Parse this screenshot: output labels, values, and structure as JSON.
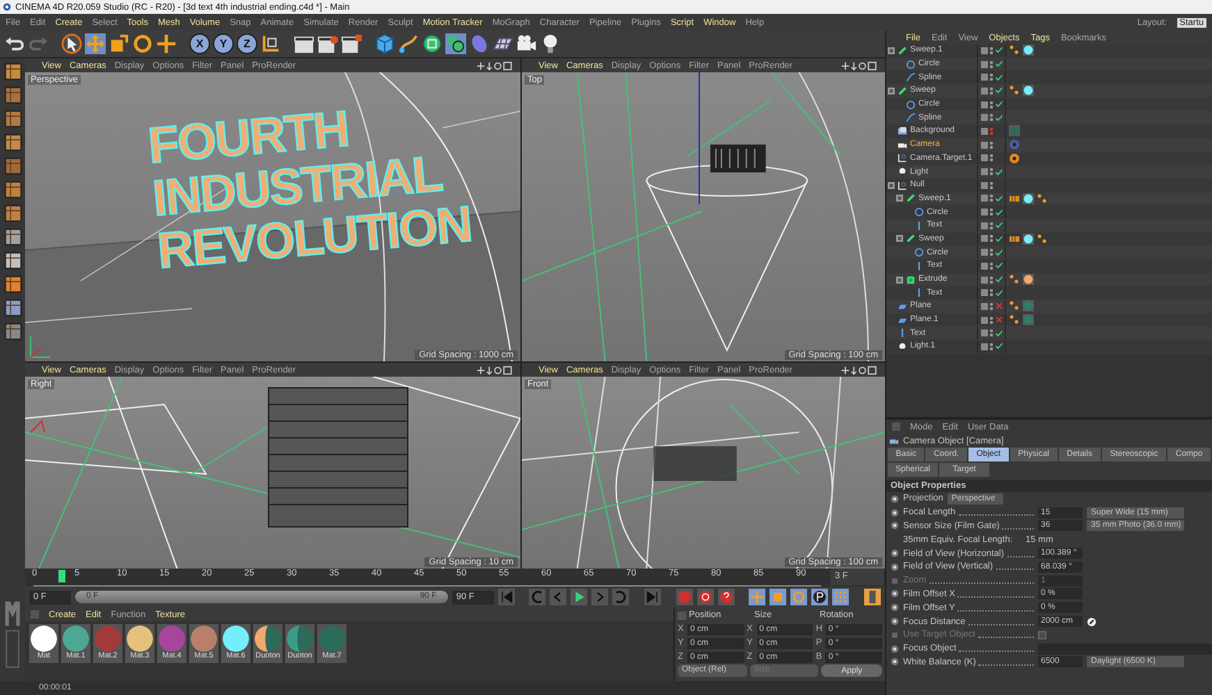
{
  "window": {
    "title": "CINEMA 4D R20.059 Studio (RC - R20) - [3d text 4th industrial ending.c4d *] - Main"
  },
  "menu": [
    {
      "label": "File",
      "highlight": false
    },
    {
      "label": "Edit",
      "highlight": false
    },
    {
      "label": "Create",
      "highlight": true
    },
    {
      "label": "Select",
      "highlight": false
    },
    {
      "label": "Tools",
      "highlight": true
    },
    {
      "label": "Mesh",
      "highlight": true
    },
    {
      "label": "Volume",
      "highlight": true
    },
    {
      "label": "Snap",
      "highlight": false
    },
    {
      "label": "Animate",
      "highlight": false
    },
    {
      "label": "Simulate",
      "highlight": false
    },
    {
      "label": "Render",
      "highlight": false
    },
    {
      "label": "Sculpt",
      "highlight": false
    },
    {
      "label": "Motion Tracker",
      "highlight": true
    },
    {
      "label": "MoGraph",
      "highlight": false
    },
    {
      "label": "Character",
      "highlight": false
    },
    {
      "label": "Pipeline",
      "highlight": false
    },
    {
      "label": "Plugins",
      "highlight": false
    },
    {
      "label": "Script",
      "highlight": true
    },
    {
      "label": "Window",
      "highlight": true
    },
    {
      "label": "Help",
      "highlight": false
    }
  ],
  "layout": {
    "label": "Layout:",
    "value": "Startu"
  },
  "toolbar": {
    "axes": [
      "X",
      "Y",
      "Z"
    ]
  },
  "viewports": [
    {
      "label": "Perspective",
      "kind": "perspective",
      "grid": "Grid Spacing : 1000 cm",
      "scene_text": [
        "FOURTH",
        "INDUSTRIAL",
        "REVOLUTION"
      ],
      "menu": [
        {
          "label": "View",
          "highlight": true
        },
        {
          "label": "Cameras",
          "highlight": true
        },
        {
          "label": "Display",
          "highlight": false
        },
        {
          "label": "Options",
          "highlight": false
        },
        {
          "label": "Filter",
          "highlight": false
        },
        {
          "label": "Panel",
          "highlight": false
        },
        {
          "label": "ProRender",
          "highlight": false
        }
      ]
    },
    {
      "label": "Top",
      "kind": "top",
      "grid": "Grid Spacing : 100 cm",
      "menu": [
        {
          "label": "View",
          "highlight": true
        },
        {
          "label": "Cameras",
          "highlight": true
        },
        {
          "label": "Display",
          "highlight": false
        },
        {
          "label": "Options",
          "highlight": false
        },
        {
          "label": "Filter",
          "highlight": false
        },
        {
          "label": "Panel",
          "highlight": false
        },
        {
          "label": "ProRender",
          "highlight": false
        }
      ]
    },
    {
      "label": "Right",
      "kind": "right",
      "grid": "Grid Spacing : 10 cm",
      "menu": [
        {
          "label": "View",
          "highlight": true
        },
        {
          "label": "Cameras",
          "highlight": true
        },
        {
          "label": "Display",
          "highlight": false
        },
        {
          "label": "Options",
          "highlight": false
        },
        {
          "label": "Filter",
          "highlight": false
        },
        {
          "label": "Panel",
          "highlight": false
        },
        {
          "label": "ProRender",
          "highlight": false
        }
      ]
    },
    {
      "label": "Front",
      "kind": "front",
      "grid": "Grid Spacing : 100 cm",
      "menu": [
        {
          "label": "View",
          "highlight": true
        },
        {
          "label": "Cameras",
          "highlight": true
        },
        {
          "label": "Display",
          "highlight": false
        },
        {
          "label": "Options",
          "highlight": false
        },
        {
          "label": "Filter",
          "highlight": false
        },
        {
          "label": "Panel",
          "highlight": false
        },
        {
          "label": "ProRender",
          "highlight": false
        }
      ]
    }
  ],
  "timeline": {
    "ticks": [
      "0",
      "5",
      "10",
      "15",
      "20",
      "25",
      "30",
      "35",
      "40",
      "45",
      "50",
      "55",
      "60",
      "65",
      "70",
      "75",
      "80",
      "85",
      "90"
    ],
    "level": 0.0333,
    "current": "3 F"
  },
  "transport": {
    "level": 1,
    "start": "0 F",
    "range_start": "0 F",
    "range_end": "90 F",
    "end": "90 F"
  },
  "materials": {
    "menu": [
      {
        "label": "Create",
        "highlight": true
      },
      {
        "label": "Edit",
        "highlight": true
      },
      {
        "label": "Function",
        "highlight": false
      },
      {
        "label": "Texture",
        "highlight": true
      }
    ],
    "items": [
      {
        "name": "Mat",
        "kind": "plain",
        "color": "#ffffff"
      },
      {
        "name": "Mat.1",
        "kind": "plain",
        "color": "#4aa893"
      },
      {
        "name": "Mat.2",
        "kind": "plain",
        "color": "#a23a3c"
      },
      {
        "name": "Mat.3",
        "kind": "plain",
        "color": "#e6c07c"
      },
      {
        "name": "Mat.4",
        "kind": "plain",
        "color": "#a8449e"
      },
      {
        "name": "Mat.5",
        "kind": "plain",
        "color": "#b8806a"
      },
      {
        "name": "Mat.6",
        "kind": "plain",
        "color": "#74eefc"
      },
      {
        "name": "Duoton",
        "kind": "duo",
        "color": "#f2a86a"
      },
      {
        "name": "Duoton",
        "kind": "duo",
        "color": "#3c9c88"
      },
      {
        "name": "Mat.7",
        "kind": "plain",
        "color": "#2c6a5a"
      }
    ]
  },
  "coordinates": {
    "headers": [
      "Position",
      "Size",
      "Rotation"
    ],
    "rows": [
      {
        "axis": "X",
        "position": "0 cm",
        "size_axis": "X",
        "size": "0 cm",
        "rotation_axis": "H",
        "rotation": "0 °"
      },
      {
        "axis": "Y",
        "position": "0 cm",
        "size_axis": "Y",
        "size": "0 cm",
        "rotation_axis": "P",
        "rotation": "0 °"
      },
      {
        "axis": "Z",
        "position": "0 cm",
        "size_axis": "Z",
        "size": "0 cm",
        "rotation_axis": "B",
        "rotation": "0 °"
      }
    ],
    "mode": "Object (Rel)",
    "size_mode": "Size",
    "apply": "Apply"
  },
  "status_bar": {
    "time": "00:00:01"
  },
  "object_manager": {
    "menu": [
      {
        "label": "File",
        "highlight": true
      },
      {
        "label": "Edit",
        "highlight": false
      },
      {
        "label": "View",
        "highlight": false
      },
      {
        "label": "Objects",
        "highlight": true
      },
      {
        "label": "Tags",
        "highlight": true
      },
      {
        "label": "Bookmarks",
        "highlight": false
      }
    ],
    "objects": [
      {
        "name": "Sweep.1",
        "kind": "sweep",
        "selected": false,
        "expanded": true,
        "hidden": false,
        "enabled": true,
        "tags": [
          {
            "kind": "phong"
          },
          {
            "kind": "material",
            "color": "#74eefc"
          }
        ],
        "children": [
          {
            "name": "Circle",
            "kind": "circle",
            "selected": false,
            "hidden": false,
            "enabled": true
          },
          {
            "name": "Spline",
            "kind": "spline",
            "selected": false,
            "hidden": false,
            "enabled": true
          }
        ]
      },
      {
        "name": "Sweep",
        "kind": "sweep",
        "selected": false,
        "expanded": true,
        "hidden": false,
        "enabled": true,
        "tags": [
          {
            "kind": "phong"
          },
          {
            "kind": "material",
            "color": "#74eefc"
          }
        ],
        "children": [
          {
            "name": "Circle",
            "kind": "circle",
            "selected": false,
            "hidden": false,
            "enabled": true
          },
          {
            "name": "Spline",
            "kind": "spline",
            "selected": false,
            "hidden": false,
            "enabled": true
          }
        ]
      },
      {
        "name": "Background",
        "kind": "background",
        "selected": false,
        "hidden": true,
        "tags": [
          {
            "kind": "material",
            "color": "#2c6a5a"
          }
        ]
      },
      {
        "name": "Camera",
        "kind": "camera",
        "selected": true,
        "hidden": false,
        "tags": [
          {
            "kind": "round",
            "color": "#4a5c9c"
          }
        ]
      },
      {
        "name": "Camera.Target.1",
        "kind": "target",
        "selected": false,
        "hidden": false,
        "tags": [
          {
            "kind": "round",
            "color": "#e0861e"
          }
        ]
      },
      {
        "name": "Light",
        "kind": "light",
        "selected": false,
        "hidden": false,
        "enabled": true
      },
      {
        "name": "Null",
        "kind": "null",
        "selected": false,
        "expanded": true,
        "hidden": false,
        "children": [
          {
            "name": "Sweep.1",
            "kind": "sweep",
            "selected": false,
            "expanded": true,
            "hidden": false,
            "enabled": true,
            "tags": [
              {
                "kind": "uvw"
              },
              {
                "kind": "material",
                "color": "#74eefc"
              },
              {
                "kind": "phong"
              }
            ],
            "children": [
              {
                "name": "Circle",
                "kind": "circle",
                "selected": false,
                "hidden": false,
                "enabled": true
              },
              {
                "name": "Text",
                "kind": "text",
                "selected": false,
                "hidden": false,
                "enabled": true
              }
            ]
          },
          {
            "name": "Sweep",
            "kind": "sweep",
            "selected": false,
            "expanded": true,
            "hidden": false,
            "enabled": true,
            "tags": [
              {
                "kind": "uvw"
              },
              {
                "kind": "material",
                "color": "#74eefc"
              },
              {
                "kind": "phong"
              }
            ],
            "children": [
              {
                "name": "Circle",
                "kind": "circle",
                "selected": false,
                "hidden": false,
                "enabled": true
              },
              {
                "name": "Text",
                "kind": "text",
                "selected": false,
                "hidden": false,
                "enabled": true
              }
            ]
          },
          {
            "name": "Extrude",
            "kind": "extrude",
            "selected": false,
            "expanded": true,
            "hidden": false,
            "enabled": true,
            "tags": [
              {
                "kind": "phong"
              },
              {
                "kind": "material",
                "color": "#f2a86a"
              }
            ],
            "children": [
              {
                "name": "Text",
                "kind": "text",
                "selected": false,
                "hidden": false,
                "enabled": true
              }
            ]
          }
        ]
      },
      {
        "name": "Plane",
        "kind": "plane",
        "selected": false,
        "hidden": false,
        "enabled": false,
        "tags": [
          {
            "kind": "phong"
          },
          {
            "kind": "material",
            "color": "#2e7c6a"
          }
        ]
      },
      {
        "name": "Plane.1",
        "kind": "plane",
        "selected": false,
        "hidden": false,
        "enabled": false,
        "tags": [
          {
            "kind": "phong"
          },
          {
            "kind": "material",
            "color": "#2e7c6a"
          }
        ]
      },
      {
        "name": "Text",
        "kind": "text",
        "selected": false,
        "hidden": false,
        "enabled": true
      },
      {
        "name": "Light.1",
        "kind": "light",
        "selected": false,
        "hidden": false,
        "enabled": true
      }
    ]
  },
  "attributes": {
    "menu": [
      "Mode",
      "Edit",
      "User Data"
    ],
    "title": "Camera Object [Camera]",
    "tab_rows": [
      [
        {
          "label": "Basic",
          "selected": false
        },
        {
          "label": "Coord.",
          "selected": false
        },
        {
          "label": "Object",
          "selected": true
        },
        {
          "label": "Physical",
          "selected": false
        },
        {
          "label": "Details",
          "selected": false
        },
        {
          "label": "Stereoscopic",
          "selected": false
        },
        {
          "label": "Compo",
          "selected": false
        }
      ],
      [
        {
          "label": "Spherical",
          "selected": false
        },
        {
          "label": "Target",
          "selected": false
        }
      ]
    ],
    "section": "Object Properties",
    "properties": [
      {
        "kind": "select",
        "label": "Projection",
        "dropdown": "Perspective",
        "disabled": false
      },
      {
        "kind": "number",
        "label": "Focal Length",
        "value": "15",
        "dropdown": "Super Wide (15 mm)",
        "disabled": false
      },
      {
        "kind": "number",
        "label": "Sensor Size (Film Gate)",
        "value": "36",
        "dropdown": "35 mm Photo (36.0 mm)",
        "disabled": false
      },
      {
        "kind": "info",
        "label": "35mm Equiv. Focal Length:",
        "value": "15 mm",
        "disabled": false
      },
      {
        "kind": "number",
        "label": "Field of View (Horizontal)",
        "value": "100.389 °",
        "disabled": false
      },
      {
        "kind": "number",
        "label": "Field of View (Vertical)",
        "value": "68.039 °",
        "disabled": false
      },
      {
        "kind": "number",
        "label": "Zoom",
        "value": "1",
        "disabled": true
      },
      {
        "kind": "number",
        "label": "Film Offset X",
        "value": "0 %",
        "disabled": false
      },
      {
        "kind": "number",
        "label": "Film Offset Y",
        "value": "0 %",
        "disabled": false
      },
      {
        "kind": "distance",
        "label": "Focus Distance",
        "value": "2000 cm",
        "disabled": false
      },
      {
        "kind": "checkbox",
        "label": "Use Target Object",
        "checked": false,
        "disabled": true
      },
      {
        "kind": "object",
        "label": "Focus Object",
        "disabled": false
      },
      {
        "kind": "number",
        "label": "White Balance (K)",
        "value": "6500",
        "dropdown": "Daylight (6500 K)",
        "disabled": false
      }
    ]
  }
}
